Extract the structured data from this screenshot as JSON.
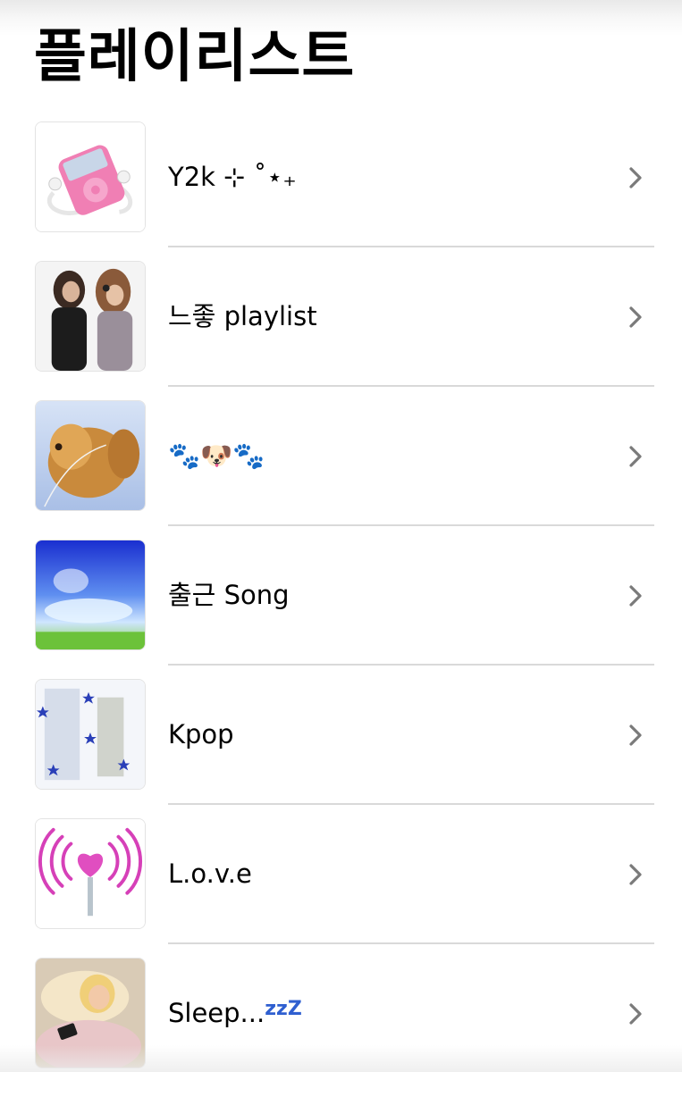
{
  "header": {
    "title": "플레이리스트"
  },
  "playlists": [
    {
      "name": "Y2k ⊹ ˚⋆₊",
      "thumbnail": "pink-mp3-player"
    },
    {
      "name": "느좋 playlist",
      "thumbnail": "two-girls-headphones"
    },
    {
      "name": "🐾🐶🐾",
      "thumbnail": "dog-with-earphones"
    },
    {
      "name": "출근 Song",
      "thumbnail": "dreamy-blue-sky"
    },
    {
      "name": "Kpop",
      "thumbnail": "blurry-stars-room"
    },
    {
      "name": "L.o.v.e",
      "thumbnail": "heart-signal-lollipop"
    },
    {
      "name": "Sleep...",
      "name_suffix": "zzZ",
      "thumbnail": "sleeping-doll"
    }
  ],
  "colors": {
    "chevron": "#7a7a7a",
    "divider": "#d9d9d9",
    "suffix_blue": "#2f5fd0"
  }
}
